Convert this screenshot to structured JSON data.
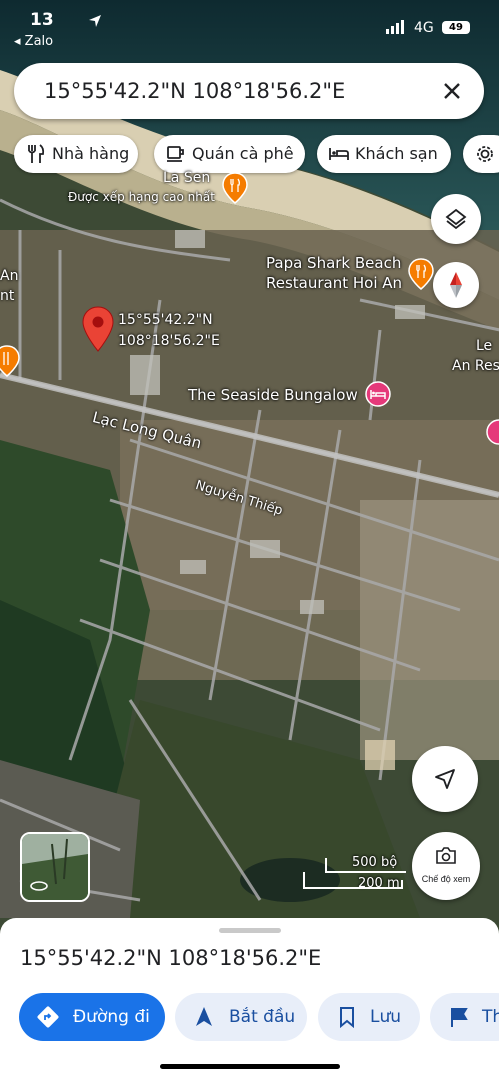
{
  "status_bar": {
    "time": "13",
    "back_label": "◂ Zalo",
    "network": "4G",
    "battery": "49"
  },
  "search": {
    "query": "15°55'42.2\"N 108°18'56.2\"E"
  },
  "chips": [
    {
      "label": "Nhà hàng",
      "icon": "fork-knife-icon"
    },
    {
      "label": "Quán cà phê",
      "icon": "coffee-icon"
    },
    {
      "label": "Khách sạn",
      "icon": "bed-icon"
    }
  ],
  "map": {
    "pin_label_line1": "15°55'42.2\"N",
    "pin_label_line2": "108°18'56.2\"E",
    "poi": [
      {
        "name": "La Sen",
        "subtitle": "Được xếp hạng cao nhất"
      },
      {
        "name_line1": "Papa Shark Beach",
        "name_line2": "Restaurant Hoi An"
      },
      {
        "name": "The Seaside Bungalow"
      },
      {
        "name_line1": "Le",
        "name_line2": "An Res"
      },
      {
        "name_line1": "An",
        "name_line2": "nt"
      }
    ],
    "streets": [
      "Lạc Long Quân",
      "Nguyễn Thiếp"
    ],
    "scale": {
      "top": "500 bộ",
      "bottom": "200 m"
    },
    "view_mode_label": "Chế độ xem",
    "colors": {
      "pin": "#ea4335",
      "poi_food": "#f57c00",
      "poi_hotel": "#e5397a",
      "primary": "#1a73e8"
    }
  },
  "sheet": {
    "coordinates": "15°55'42.2\"N 108°18'56.2\"E",
    "actions": [
      {
        "label": "Đường đi",
        "icon": "directions-icon"
      },
      {
        "label": "Bắt đầu",
        "icon": "navigation-arrow-icon"
      },
      {
        "label": "Lưu",
        "icon": "bookmark-icon"
      },
      {
        "label": "Th",
        "icon": "flag-icon"
      }
    ]
  }
}
